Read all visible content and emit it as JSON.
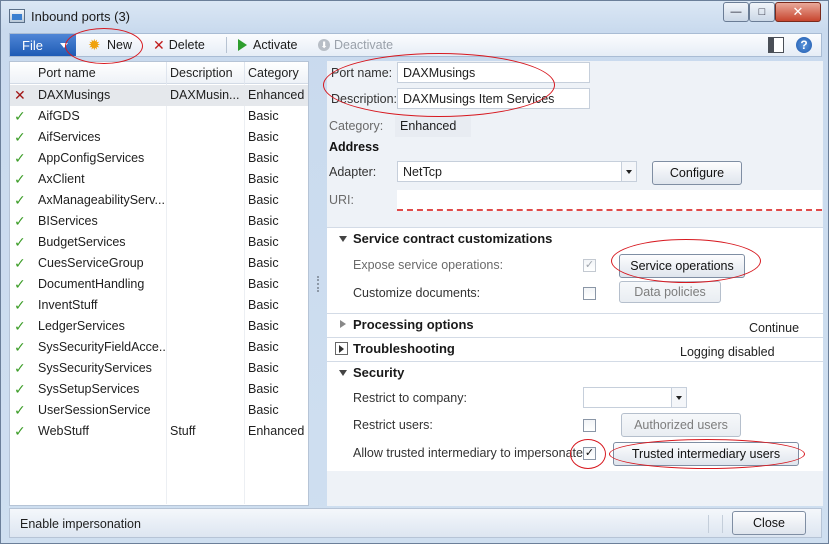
{
  "window": {
    "title": "Inbound ports (3)",
    "min_glyph": "—",
    "max_glyph": "□",
    "close_glyph": "✕"
  },
  "toolbar": {
    "file_label": "File",
    "new_label": "New",
    "delete_label": "Delete",
    "activate_label": "Activate",
    "deactivate_label": "Deactivate"
  },
  "grid": {
    "columns": [
      "Port name",
      "Description",
      "Category"
    ],
    "rows": [
      {
        "status": "error",
        "name": "DAXMusings",
        "description": "DAXMusin...",
        "category": "Enhanced"
      },
      {
        "status": "ok",
        "name": "AifGDS",
        "description": "",
        "category": "Basic"
      },
      {
        "status": "ok",
        "name": "AifServices",
        "description": "",
        "category": "Basic"
      },
      {
        "status": "ok",
        "name": "AppConfigServices",
        "description": "",
        "category": "Basic"
      },
      {
        "status": "ok",
        "name": "AxClient",
        "description": "",
        "category": "Basic"
      },
      {
        "status": "ok",
        "name": "AxManageabilityServ...",
        "description": "",
        "category": "Basic"
      },
      {
        "status": "ok",
        "name": "BIServices",
        "description": "",
        "category": "Basic"
      },
      {
        "status": "ok",
        "name": "BudgetServices",
        "description": "",
        "category": "Basic"
      },
      {
        "status": "ok",
        "name": "CuesServiceGroup",
        "description": "",
        "category": "Basic"
      },
      {
        "status": "ok",
        "name": "DocumentHandling",
        "description": "",
        "category": "Basic"
      },
      {
        "status": "ok",
        "name": "InventStuff",
        "description": "",
        "category": "Basic"
      },
      {
        "status": "ok",
        "name": "LedgerServices",
        "description": "",
        "category": "Basic"
      },
      {
        "status": "ok",
        "name": "SysSecurityFieldAcce...",
        "description": "",
        "category": "Basic"
      },
      {
        "status": "ok",
        "name": "SysSecurityServices",
        "description": "",
        "category": "Basic"
      },
      {
        "status": "ok",
        "name": "SysSetupServices",
        "description": "",
        "category": "Basic"
      },
      {
        "status": "ok",
        "name": "UserSessionService",
        "description": "",
        "category": "Basic"
      },
      {
        "status": "ok",
        "name": "WebStuff",
        "description": "Stuff",
        "category": "Enhanced"
      }
    ]
  },
  "detail": {
    "port_name_label": "Port name:",
    "port_name_value": "DAXMusings",
    "description_label": "Description:",
    "description_value": "DAXMusings Item Services",
    "category_label": "Category:",
    "category_value": "Enhanced",
    "address_heading": "Address",
    "adapter_label": "Adapter:",
    "adapter_value": "NetTcp",
    "configure_label": "Configure",
    "uri_label": "URI:",
    "uri_value": ""
  },
  "service_contract": {
    "title": "Service contract customizations",
    "expose_label": "Expose service operations:",
    "expose_checked": true,
    "service_operations_label": "Service operations",
    "customize_label": "Customize documents:",
    "customize_checked": false,
    "data_policies_label": "Data policies"
  },
  "processing": {
    "title": "Processing options",
    "status": "Continue"
  },
  "troubleshooting": {
    "title": "Troubleshooting",
    "status": "Logging disabled"
  },
  "security": {
    "title": "Security",
    "restrict_company_label": "Restrict to company:",
    "restrict_company_value": "",
    "restrict_users_label": "Restrict users:",
    "restrict_users_checked": false,
    "authorized_users_label": "Authorized users",
    "allow_trusted_label": "Allow trusted intermediary to impersonate:",
    "allow_trusted_checked": true,
    "trusted_users_label": "Trusted intermediary users"
  },
  "statusbar": {
    "text": "Enable impersonation",
    "close_label": "Close"
  },
  "glyphs": {
    "check": "✓",
    "error": "✕",
    "new": "✹",
    "delete": "✕",
    "help": "?"
  },
  "colors": {
    "accent": "#1f5bb5",
    "ok": "#3c9d28",
    "error": "#a11616",
    "annotation": "#d71920"
  }
}
